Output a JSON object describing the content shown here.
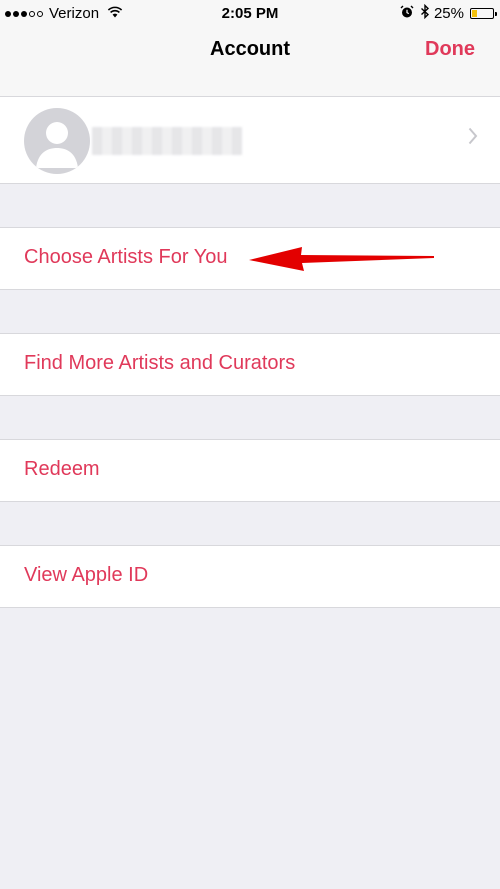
{
  "status_bar": {
    "carrier": "Verizon",
    "time": "2:05 PM",
    "battery_percent": "25%",
    "battery_level": 0.25,
    "icons": [
      "signal-dots-icon",
      "wifi-icon",
      "alarm-icon",
      "bluetooth-icon",
      "battery-icon"
    ]
  },
  "nav": {
    "title": "Account",
    "done_label": "Done"
  },
  "profile": {
    "avatar_icon": "person-silhouette-icon",
    "name_blurred": true,
    "chevron_icon": "chevron-right-icon"
  },
  "menu": {
    "items": [
      {
        "label": "Choose Artists For You"
      },
      {
        "label": "Find More Artists and Curators"
      },
      {
        "label": "Redeem"
      },
      {
        "label": "View Apple ID"
      }
    ]
  },
  "annotation": {
    "icon": "red-arrow-icon",
    "color": "#e30000"
  },
  "colors": {
    "accent": "#e0395a",
    "background": "#efeff4",
    "cell": "#ffffff",
    "battery": "#f4c20d"
  }
}
